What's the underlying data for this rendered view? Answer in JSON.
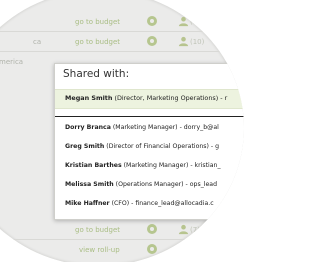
{
  "background_rows": [
    {
      "link": "go to budget",
      "count": "(11)",
      "action": "edit",
      "left_text": ""
    },
    {
      "link": "go to budget",
      "count": "(10)",
      "action": "edit",
      "left_text": "ca"
    },
    {
      "link": "",
      "count": "",
      "action": "",
      "left_text": "merica"
    }
  ],
  "bottom_rows": [
    {
      "link": "go to budget",
      "count": "(7)",
      "action": "edit"
    },
    {
      "link": "view roll-up",
      "count": "(7)",
      "action": ""
    }
  ],
  "popup": {
    "title": "Shared with:",
    "owner": {
      "name": "Megan Smith",
      "detail": "(Director, Marketing Operations) - r"
    },
    "members": [
      {
        "name": "Dorry Branca",
        "detail": "(Marketing Manager) - dorry_b@al"
      },
      {
        "name": "Greg Smith",
        "detail": "(Director of Financial Operations) - g"
      },
      {
        "name": "Kristian Barthes",
        "detail": "(Marketing Manager) - kristian_"
      },
      {
        "name": "Melissa Smith",
        "detail": "(Operations Manager) - ops_lead"
      },
      {
        "name": "Mike Haffner",
        "detail": "(CFO) - finance_lead@allocadia.c"
      }
    ]
  },
  "colors": {
    "lens_bg": "#ebebea",
    "accent_green": "#a9bd84",
    "owner_highlight": "#edf3df"
  }
}
